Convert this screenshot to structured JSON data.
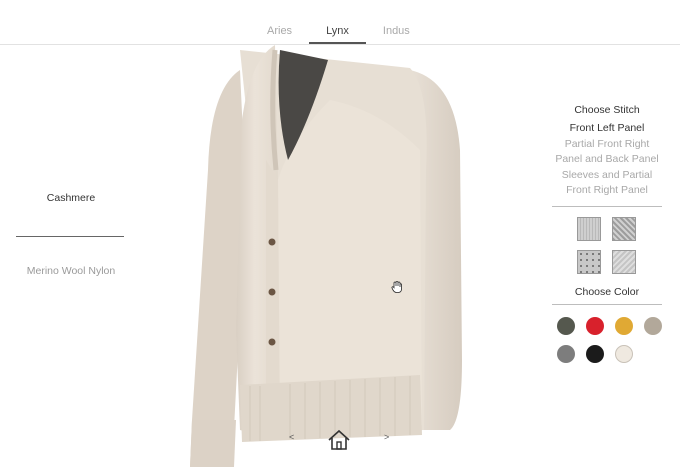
{
  "tabs": [
    "Aries",
    "Lynx",
    "Indus"
  ],
  "active_tab": "Lynx",
  "materials": {
    "selected": "Cashmere",
    "other": "Merino Wool Nylon"
  },
  "stitch": {
    "title": "Choose Stitch",
    "options": [
      "Front Left Panel",
      "Partial Front Right",
      "Panel and Back Panel",
      "Sleeves and Partial",
      "Front Right Panel"
    ],
    "selected_index": 0
  },
  "color": {
    "title": "Choose Color",
    "swatches": [
      "#55584e",
      "#d8212c",
      "#e0a934",
      "#b2a89a",
      "#7d7d7d",
      "#1b1b1b",
      "#efe9e0"
    ]
  },
  "nav": {
    "prev": "<",
    "next": ">"
  },
  "icons": {
    "home": "home-icon",
    "cursor": "hand-cursor-icon"
  }
}
